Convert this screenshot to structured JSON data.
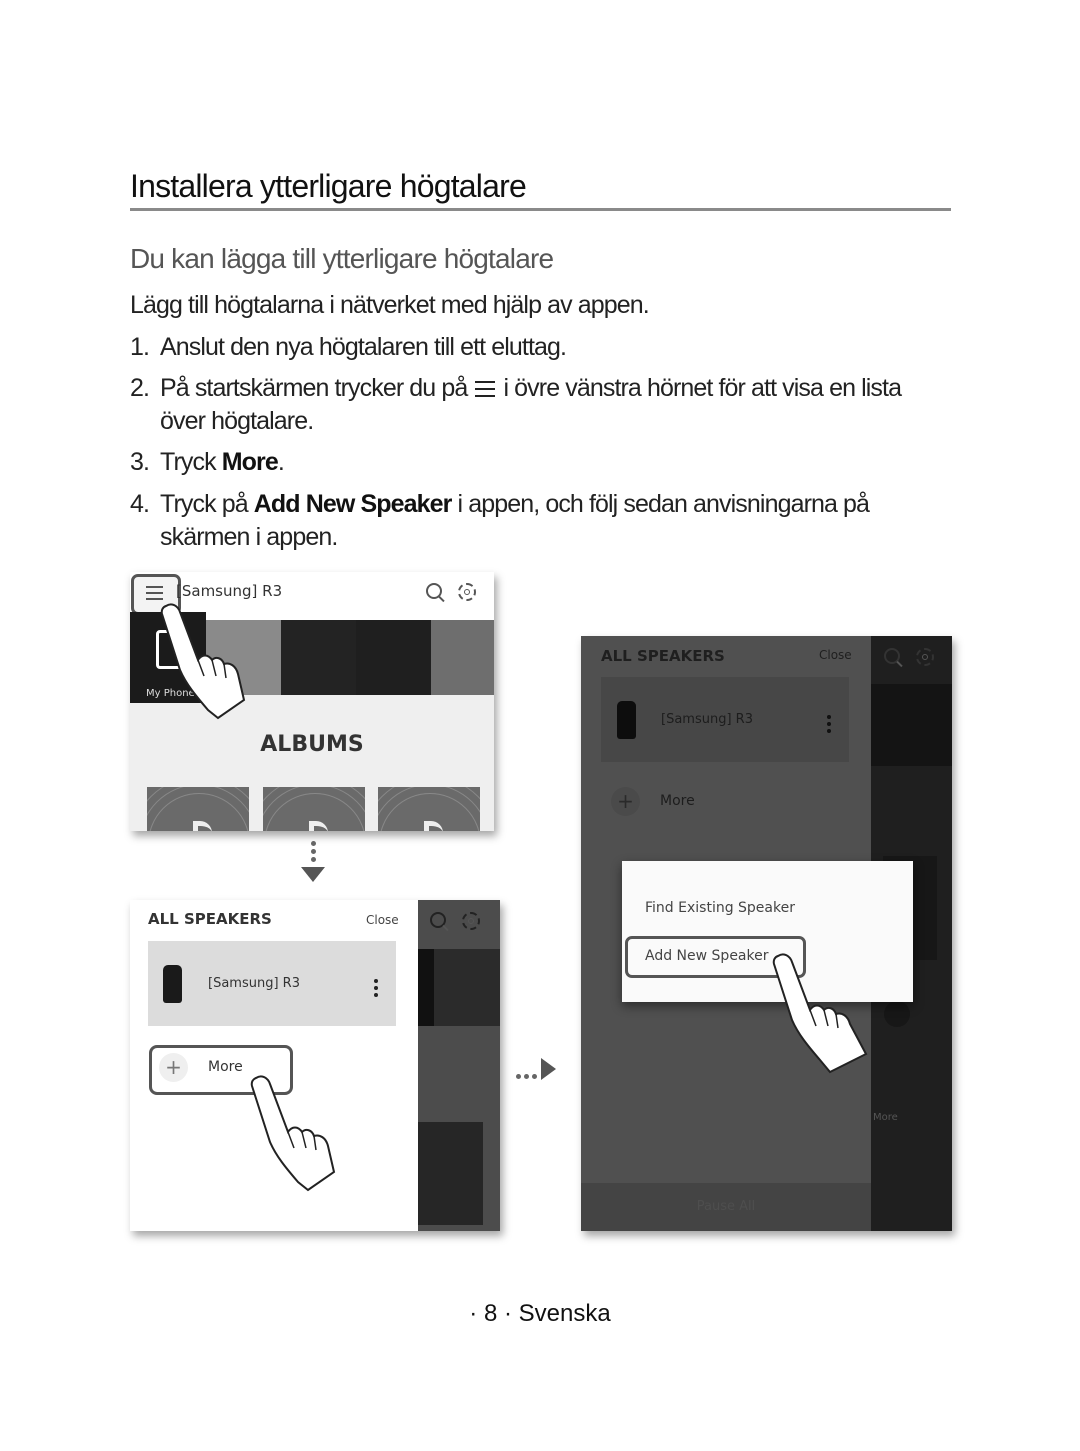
{
  "page": {
    "title": "Installera ytterligare högtalare",
    "subtitle": "Du kan lägga till ytterligare högtalare",
    "intro": "Lägg till högtalarna i nätverket med hjälp av appen.",
    "steps": [
      {
        "num": "1.",
        "text": "Anslut den nya högtalaren till ett eluttag."
      },
      {
        "num": "2.",
        "before": "På startskärmen trycker du på",
        "icon": "menu-icon",
        "after": "i övre vänstra hörnet för att visa en lista över högtalare."
      },
      {
        "num": "3.",
        "before": "Tryck ",
        "bold": "More",
        "after": "."
      },
      {
        "num": "4.",
        "before": "Tryck på ",
        "bold": "Add New Speaker",
        "after": " i appen, och följ sedan anvisningarna på skärmen i appen."
      }
    ],
    "footer": "· 8 · Svenska"
  },
  "screen1": {
    "device_title": "[Samsung] R3",
    "tile_label": "My Phone",
    "section_heading": "ALBUMS",
    "icons": [
      "menu-icon",
      "search-icon",
      "gear-icon"
    ]
  },
  "screen2": {
    "header": "ALL SPEAKERS",
    "close_label": "Close",
    "speaker_name": "[Samsung] R3",
    "more_label": "More"
  },
  "screen3": {
    "header": "ALL SPEAKERS",
    "close_label": "Close",
    "speaker_name": "[Samsung] R3",
    "more_label": "More",
    "popup_options": [
      "Find Existing Speaker",
      "Add New Speaker"
    ],
    "bg_more_label": "More",
    "pause_all_label": "Pause All"
  },
  "colors": {
    "rule": "#8a8a8a",
    "subtitle": "#555555",
    "highlight_border": "#555555"
  }
}
